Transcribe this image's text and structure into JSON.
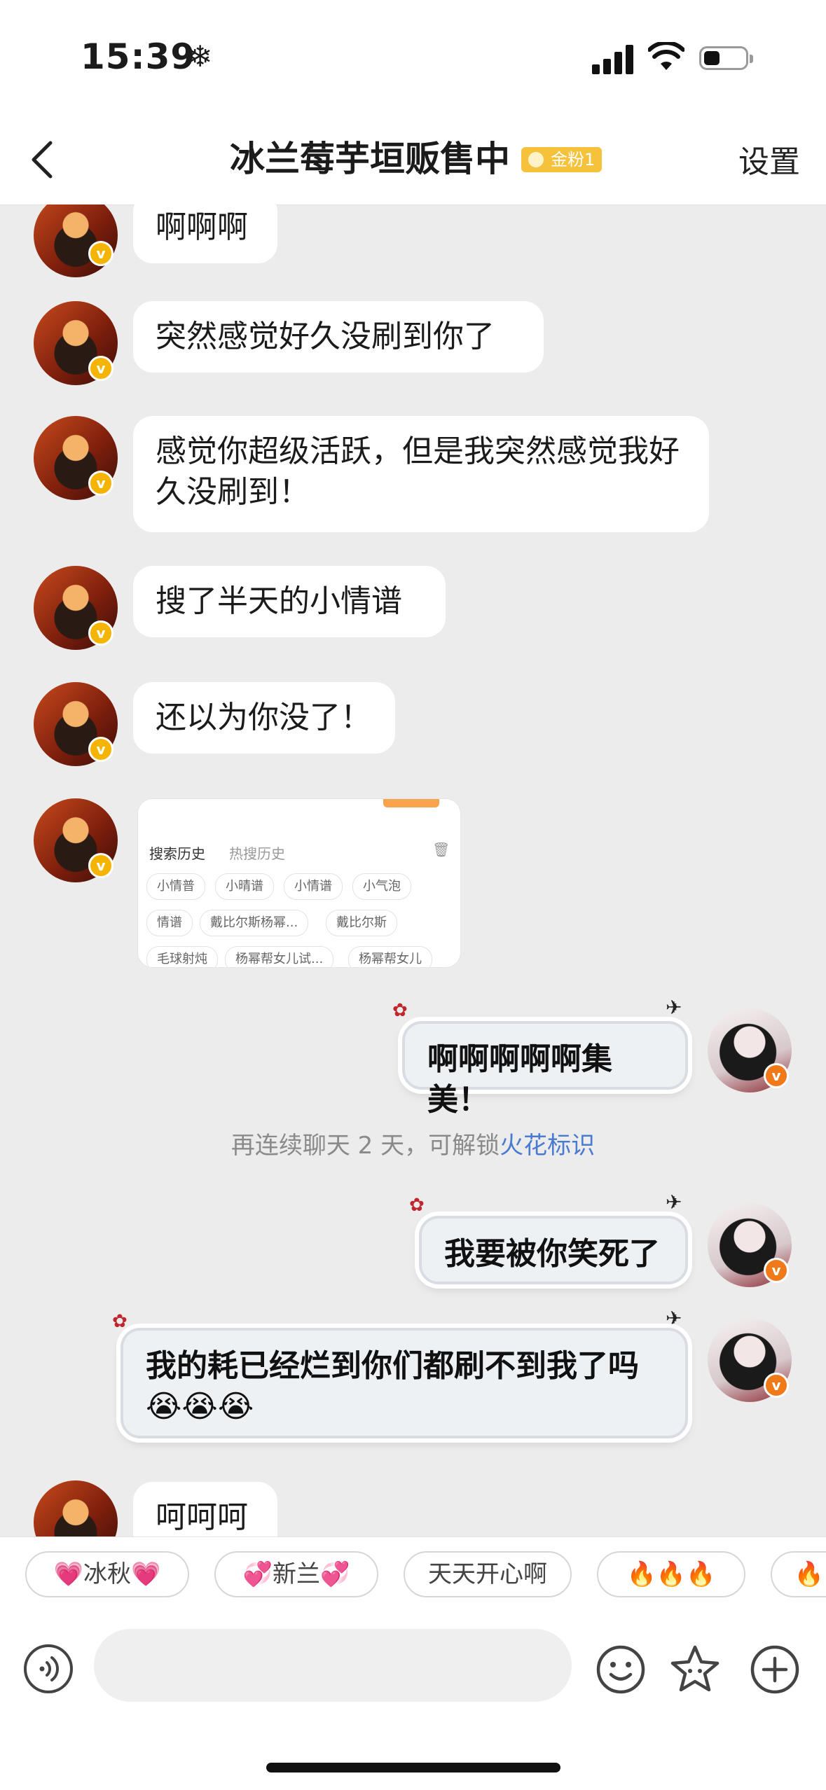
{
  "status": {
    "time": "15:39",
    "time_icon": "snowflake-icon"
  },
  "header": {
    "title": "冰兰莓芋垣贩售中",
    "badge": "金粉1",
    "settings": "设置"
  },
  "messages": [
    {
      "side": "left",
      "text": "啊啊啊"
    },
    {
      "side": "left",
      "text": "突然感觉好久没刷到你了"
    },
    {
      "side": "left",
      "text": "感觉你超级活跃，但是我突然感觉我好久没刷到！"
    },
    {
      "side": "left",
      "text": "搜了半天的小情谱"
    },
    {
      "side": "left",
      "text": "还以为你没了！"
    },
    {
      "side": "right",
      "text": "啊啊啊啊啊集美！"
    },
    {
      "side": "right",
      "text": "我要被你笑死了"
    },
    {
      "side": "right",
      "text": "我的耗已经烂到你们都刷不到我了吗😭😭😭"
    },
    {
      "side": "left",
      "text": "呵呵呵"
    }
  ],
  "shared_image": {
    "history_label": "搜索历史",
    "hot_label": "热搜历史",
    "tags": [
      "小情普",
      "小晴谱",
      "小情谱",
      "小气泡",
      "情谱",
      "戴比尔斯杨幂...",
      "戴比尔斯",
      "毛球射炖",
      "杨幂帮女儿试...",
      "杨幂帮女儿"
    ]
  },
  "notice": {
    "text": "再连续聊天 2 天，可解锁",
    "link": "火花标识"
  },
  "quick_replies": [
    "💗冰秋💗",
    "💞新兰💞",
    "天天开心啊",
    "🔥🔥🔥",
    "🔥"
  ],
  "input": {
    "placeholder": ""
  }
}
